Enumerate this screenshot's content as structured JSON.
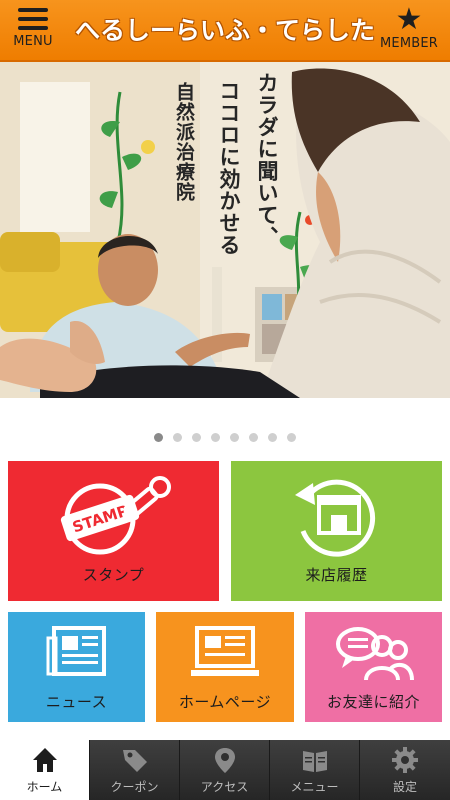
{
  "header": {
    "menu_label": "MENU",
    "title": "へるしーらいふ・てらした",
    "member_label": "MEMBER",
    "bg_color": "#f28a0f"
  },
  "hero": {
    "caption_line1": "カラダに聞いて、",
    "caption_line2": "ココロに効かせる",
    "caption_line3": "自然派治療院"
  },
  "carousel": {
    "total": 8,
    "active_index": 0
  },
  "tiles": [
    {
      "label": "スタンプ",
      "icon": "stamp-icon",
      "color": "#ef2a32"
    },
    {
      "label": "来店履歴",
      "icon": "store-history-icon",
      "color": "#8cc63f"
    },
    {
      "label": "ニュース",
      "icon": "newspaper-icon",
      "color": "#3aa9dd"
    },
    {
      "label": "ホームページ",
      "icon": "monitor-icon",
      "color": "#f7931e"
    },
    {
      "label": "お友達に紹介",
      "icon": "friends-chat-icon",
      "color": "#ef6fa4"
    }
  ],
  "tabbar": {
    "items": [
      {
        "label": "ホーム",
        "icon": "home-icon",
        "active": true
      },
      {
        "label": "クーポン",
        "icon": "tag-icon",
        "active": false
      },
      {
        "label": "アクセス",
        "icon": "map-pin-icon",
        "active": false
      },
      {
        "label": "メニュー",
        "icon": "book-icon",
        "active": false
      },
      {
        "label": "設定",
        "icon": "gear-icon",
        "active": false
      }
    ]
  }
}
